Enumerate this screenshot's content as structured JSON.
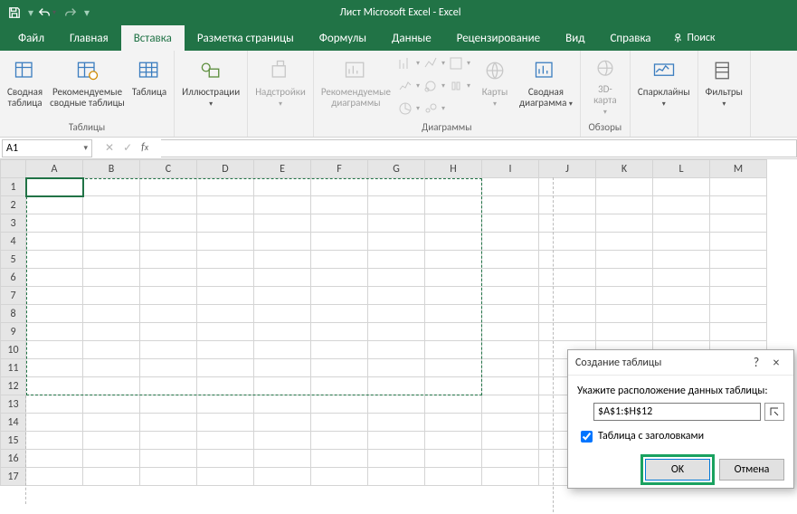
{
  "title": "Лист Microsoft Excel  -  Excel",
  "qat": {
    "save": "save",
    "undo": "undo",
    "redo": "redo"
  },
  "tabs": [
    "Файл",
    "Главная",
    "Вставка",
    "Разметка страницы",
    "Формулы",
    "Данные",
    "Рецензирование",
    "Вид",
    "Справка"
  ],
  "active_tab_index": 2,
  "search_label": "Поиск",
  "ribbon": {
    "tables": {
      "group": "Таблицы",
      "items": {
        "pivot": "Сводная\nтаблица",
        "recommend": "Рекомендуемые\nсводные таблицы",
        "table": "Таблица"
      }
    },
    "illustrations": {
      "label": "Иллюстрации"
    },
    "addins": {
      "label": "Надстройки"
    },
    "charts": {
      "group": "Диаграммы",
      "recommend": "Рекомендуемые\nдиаграммы",
      "maps": "Карты",
      "pivotchart": "Сводная\nдиаграмма"
    },
    "tours": {
      "group": "Обзоры",
      "map3d": "3D-\nкарта"
    },
    "sparklines": {
      "label": "Спарклайны"
    },
    "filters": {
      "label": "Фильтры"
    }
  },
  "namebox": "A1",
  "columns": [
    "A",
    "B",
    "C",
    "D",
    "E",
    "F",
    "G",
    "H",
    "I",
    "J",
    "K",
    "L",
    "M"
  ],
  "rows": [
    1,
    2,
    3,
    4,
    5,
    6,
    7,
    8,
    9,
    10,
    11,
    12,
    13,
    14,
    15,
    16,
    17
  ],
  "selection": {
    "range": "A1:H12",
    "active": "A1"
  },
  "dialog": {
    "title": "Создание таблицы",
    "help": "?",
    "close": "×",
    "prompt": "Укажите расположение данных таблицы:",
    "range": "$A$1:$H$12",
    "checkbox": "Таблица с заголовками",
    "checked": true,
    "ok": "OK",
    "cancel": "Отмена"
  }
}
